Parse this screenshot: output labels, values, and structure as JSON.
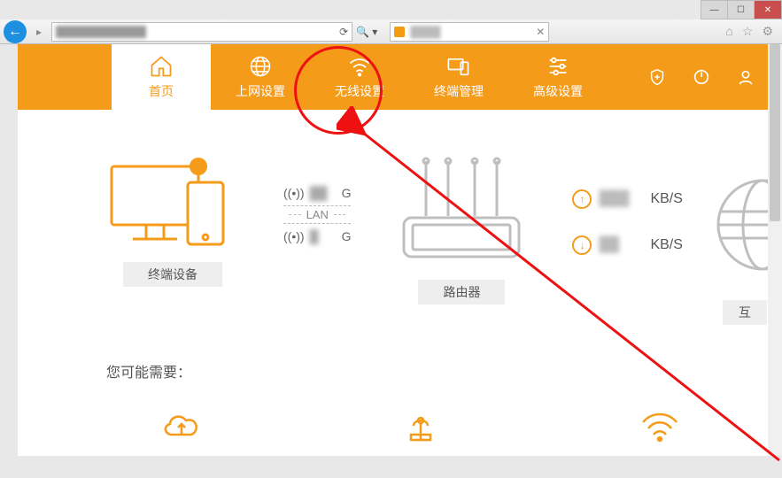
{
  "window": {
    "minimize": "—",
    "maximize": "☐",
    "close": "✕"
  },
  "browser": {
    "address_blur": "████████████",
    "tab_blur": "████",
    "icons": {
      "home": "⌂",
      "star": "☆",
      "gear": "⚙"
    }
  },
  "nav": {
    "items": [
      {
        "key": "home",
        "label": "首页"
      },
      {
        "key": "wan",
        "label": "上网设置"
      },
      {
        "key": "wifi",
        "label": "无线设置"
      },
      {
        "key": "clients",
        "label": "终端管理"
      },
      {
        "key": "advanced",
        "label": "高级设置"
      }
    ]
  },
  "dashboard": {
    "devices_label": "终端设备",
    "router_label": "路由器",
    "internet_label": "互",
    "wifi5g": "G",
    "wifi24g": "G",
    "lan_label": "LAN",
    "up_unit": "KB/S",
    "down_unit": "KB/S",
    "up_blur": "███",
    "down_blur": "██"
  },
  "need": {
    "title": "您可能需要："
  },
  "colors": {
    "accent": "#f59b1a",
    "highlight_red": "#e11"
  }
}
